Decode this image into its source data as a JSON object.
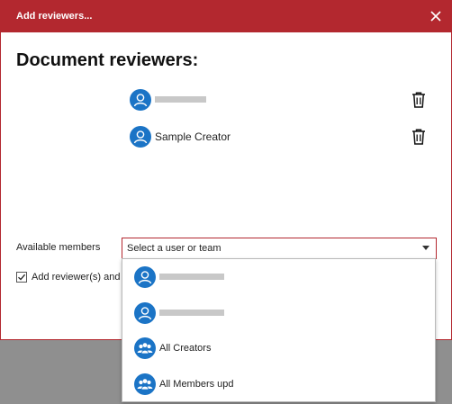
{
  "dialog": {
    "title": "Add reviewers...",
    "heading": "Document reviewers:",
    "colors": {
      "accent": "#b3282f",
      "avatar": "#1b74c6"
    }
  },
  "reviewers": [
    {
      "name": "",
      "redacted": true,
      "avatar_icon": "person-icon",
      "action_icon": "trash-icon"
    },
    {
      "name": "Sample Creator",
      "redacted": false,
      "avatar_icon": "person-icon",
      "action_icon": "trash-icon"
    }
  ],
  "members": {
    "label": "Available members",
    "select_placeholder": "Select a user or team"
  },
  "checkbox": {
    "label": "Add reviewer(s) and c",
    "checked": true
  },
  "dropdown": {
    "options": [
      {
        "name": "",
        "redacted": true,
        "icon": "person-icon"
      },
      {
        "name": "",
        "redacted": true,
        "icon": "person-icon"
      },
      {
        "name": "All Creators",
        "redacted": false,
        "icon": "team-icon"
      },
      {
        "name": "All Members upd",
        "redacted": false,
        "icon": "team-icon"
      }
    ]
  }
}
